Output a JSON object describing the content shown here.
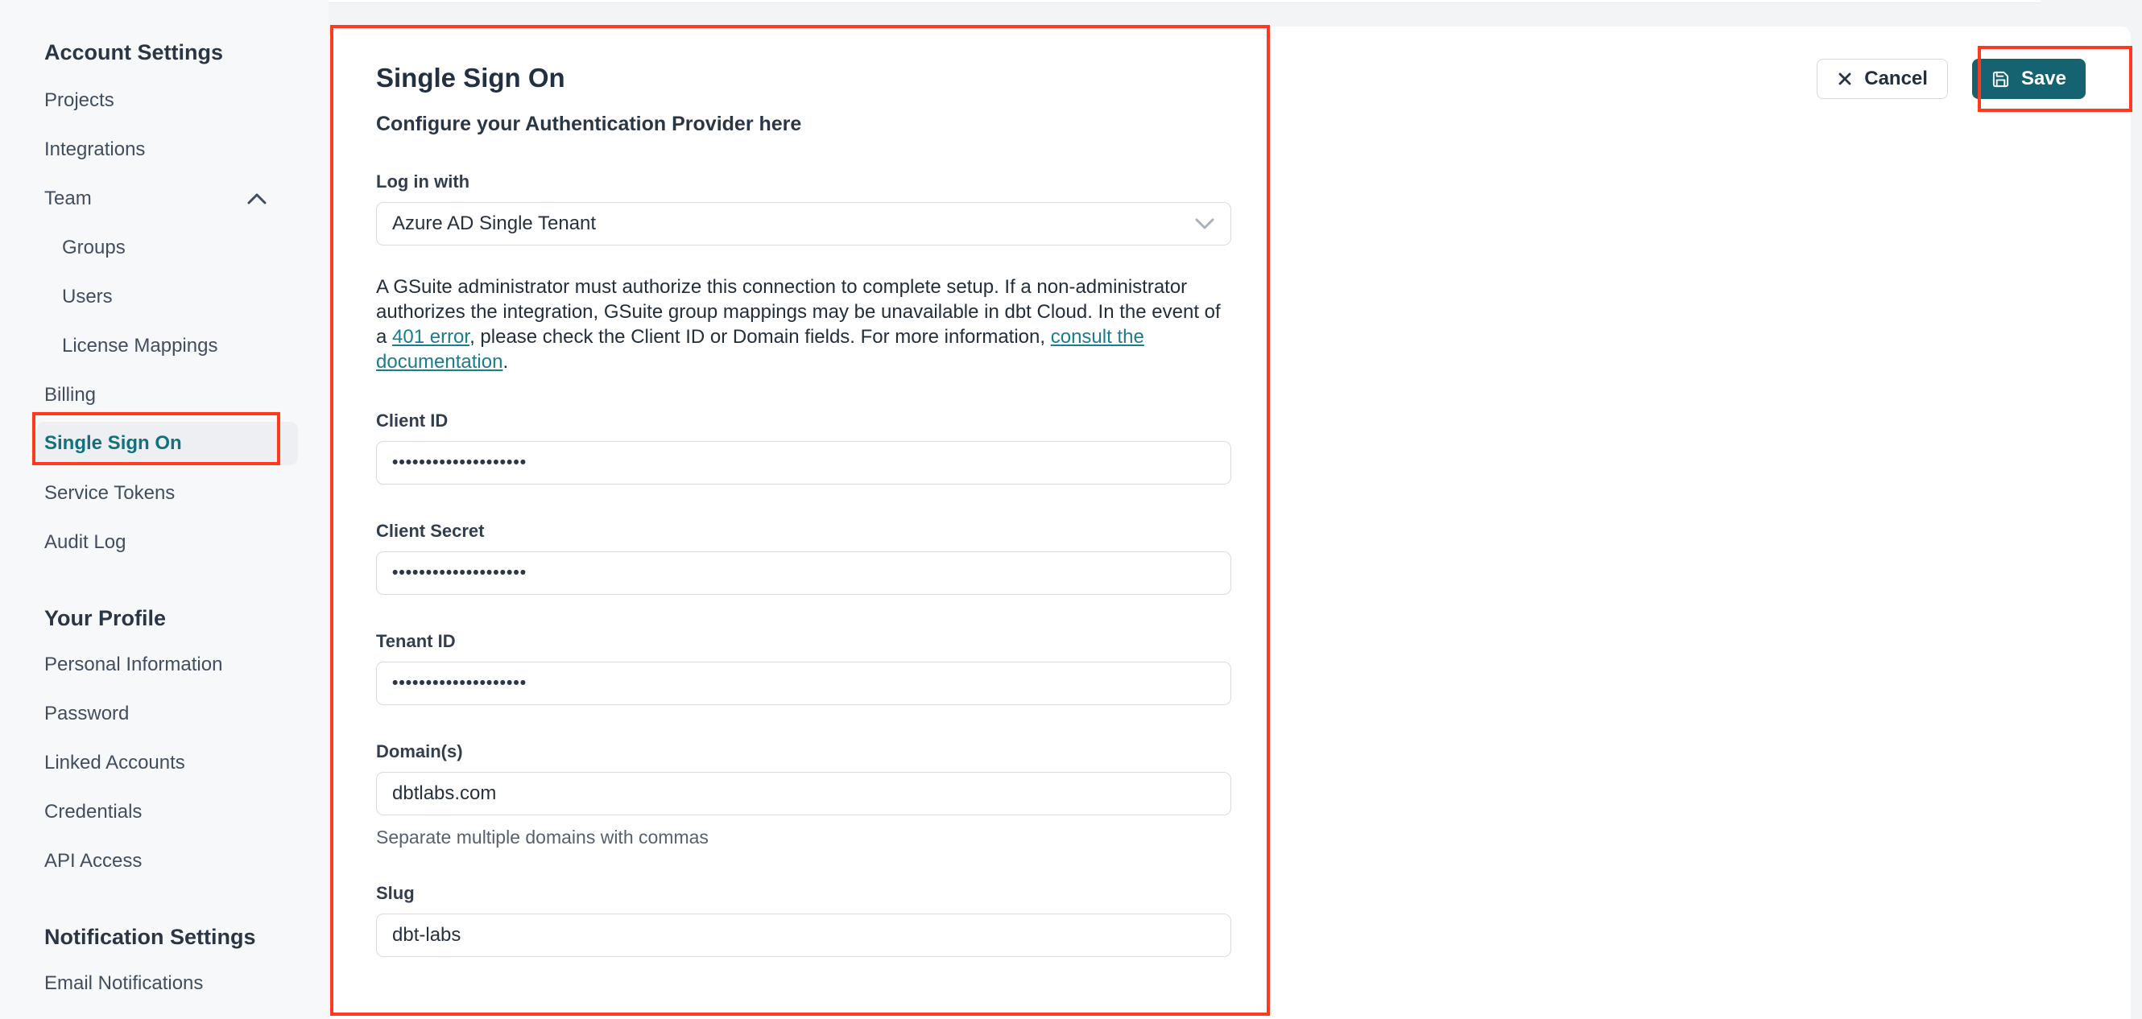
{
  "sidebar": {
    "sections": [
      {
        "header": "Account Settings",
        "items": [
          {
            "label": "Projects"
          },
          {
            "label": "Integrations"
          },
          {
            "label": "Team"
          },
          {
            "label": "Groups"
          },
          {
            "label": "Users"
          },
          {
            "label": "License Mappings"
          },
          {
            "label": "Billing"
          },
          {
            "label": "Single Sign On"
          },
          {
            "label": "Service Tokens"
          },
          {
            "label": "Audit Log"
          }
        ]
      },
      {
        "header": "Your Profile",
        "items": [
          {
            "label": "Personal Information"
          },
          {
            "label": "Password"
          },
          {
            "label": "Linked Accounts"
          },
          {
            "label": "Credentials"
          },
          {
            "label": "API Access"
          }
        ]
      },
      {
        "header": "Notification Settings",
        "items": [
          {
            "label": "Email Notifications"
          }
        ]
      }
    ]
  },
  "main": {
    "title": "Single Sign On",
    "subtitle": "Configure your Authentication Provider here",
    "login_with": {
      "label": "Log in with",
      "value": "Azure AD Single Tenant"
    },
    "notice": {
      "part1": "A GSuite administrator must authorize this connection to complete setup. If a non-administrator authorizes the integration, GSuite group mappings may be unavailable in dbt Cloud. In the event of a ",
      "link1": "401 error",
      "part2": ", please check the Client ID or Domain fields. For more information, ",
      "link2": "consult the documentation",
      "part3": "."
    },
    "fields": [
      {
        "label": "Client ID",
        "value": "••••••••••••••••••••",
        "masked": true
      },
      {
        "label": "Client Secret",
        "value": "••••••••••••••••••••",
        "masked": true
      },
      {
        "label": "Tenant ID",
        "value": "••••••••••••••••••••",
        "masked": true
      },
      {
        "label": "Domain(s)",
        "value": "dbtlabs.com",
        "helper": "Separate multiple domains with commas"
      },
      {
        "label": "Slug",
        "value": "dbt-labs"
      }
    ],
    "buttons": {
      "cancel": "Cancel",
      "save": "Save"
    }
  },
  "icons": {
    "team_chevron": "chevron-up-icon",
    "select_chevron": "chevron-down-icon",
    "cancel": "x-icon",
    "save": "floppy-disk-icon"
  },
  "colors": {
    "annotation_red": "#ff3a1e",
    "save_button_teal": "#156370",
    "link_teal": "#187e8c",
    "active_item_teal": "#11717f",
    "sidebar_bg": "#f7f8fa",
    "page_bg": "#f3f4f6",
    "card_bg": "#ffffff"
  }
}
